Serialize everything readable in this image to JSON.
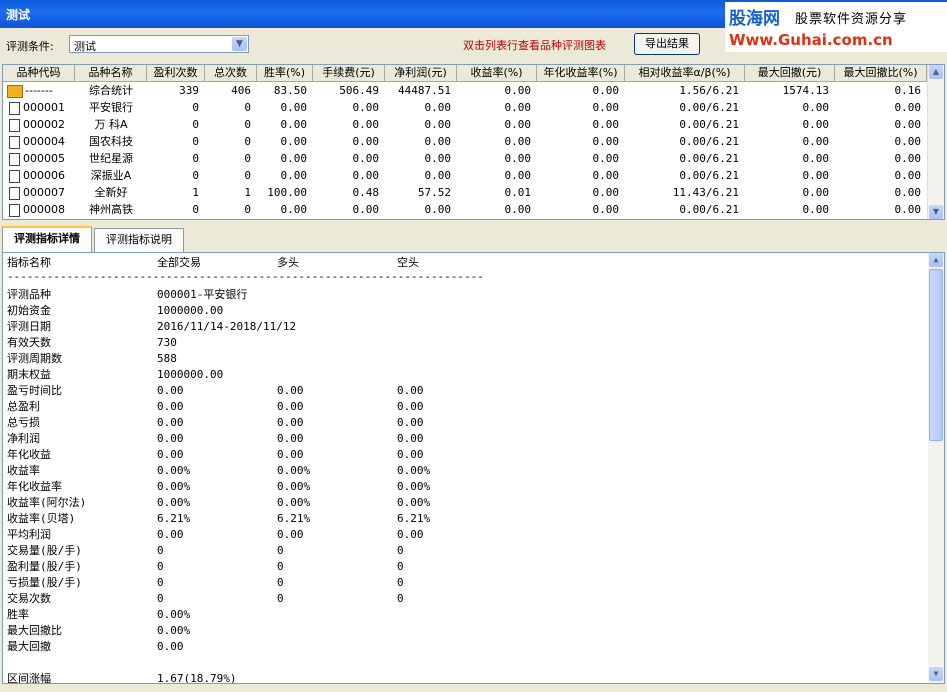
{
  "window": {
    "title": "测试"
  },
  "logo": {
    "line1_a": "股海网",
    "line1_b": "股票软件资源分享",
    "line2": "Www.Guhai.com.cn"
  },
  "condition": {
    "label": "评测条件:",
    "value": "测试",
    "hint": "双击列表行查看品种评测图表",
    "export_label": "导出结果"
  },
  "grid": {
    "headers": [
      "品种代码",
      "品种名称",
      "盈利次数",
      "总次数",
      "胜率(%)",
      "手续费(元)",
      "净利润(元)",
      "收益率(%)",
      "年化收益率(%)",
      "相对收益率α/β(%)",
      "最大回撤(元)",
      "最大回撤比(%)"
    ],
    "rows": [
      {
        "icon": "folder",
        "cells": [
          "-------",
          "综合统计",
          "339",
          "406",
          "83.50",
          "506.49",
          "44487.51",
          "0.00",
          "0.00",
          "1.56/6.21",
          "1574.13",
          "0.16"
        ]
      },
      {
        "icon": "doc",
        "cells": [
          "000001",
          "平安银行",
          "0",
          "0",
          "0.00",
          "0.00",
          "0.00",
          "0.00",
          "0.00",
          "0.00/6.21",
          "0.00",
          "0.00"
        ]
      },
      {
        "icon": "doc",
        "cells": [
          "000002",
          "万 科A",
          "0",
          "0",
          "0.00",
          "0.00",
          "0.00",
          "0.00",
          "0.00",
          "0.00/6.21",
          "0.00",
          "0.00"
        ]
      },
      {
        "icon": "doc",
        "cells": [
          "000004",
          "国农科技",
          "0",
          "0",
          "0.00",
          "0.00",
          "0.00",
          "0.00",
          "0.00",
          "0.00/6.21",
          "0.00",
          "0.00"
        ]
      },
      {
        "icon": "doc",
        "cells": [
          "000005",
          "世纪星源",
          "0",
          "0",
          "0.00",
          "0.00",
          "0.00",
          "0.00",
          "0.00",
          "0.00/6.21",
          "0.00",
          "0.00"
        ]
      },
      {
        "icon": "doc",
        "cells": [
          "000006",
          "深振业A",
          "0",
          "0",
          "0.00",
          "0.00",
          "0.00",
          "0.00",
          "0.00",
          "0.00/6.21",
          "0.00",
          "0.00"
        ]
      },
      {
        "icon": "doc",
        "cells": [
          "000007",
          "全新好",
          "1",
          "1",
          "100.00",
          "0.48",
          "57.52",
          "0.01",
          "0.00",
          "11.43/6.21",
          "0.00",
          "0.00"
        ]
      },
      {
        "icon": "doc",
        "cells": [
          "000008",
          "神州高铁",
          "0",
          "0",
          "0.00",
          "0.00",
          "0.00",
          "0.00",
          "0.00",
          "0.00/6.21",
          "0.00",
          "0.00"
        ]
      }
    ]
  },
  "tabs": [
    "评测指标详情",
    "评测指标说明"
  ],
  "detail": {
    "header": [
      "指标名称",
      "全部交易",
      "多头",
      "空头"
    ],
    "separator": "------------------------------------------------------------------------",
    "rows": [
      [
        "",
        ""
      ],
      [
        "评测品种",
        "000001-平安银行"
      ],
      [
        "初始资金",
        "1000000.00"
      ],
      [
        "评测日期",
        "2016/11/14-2018/11/12"
      ],
      [
        "有效天数",
        "730"
      ],
      [
        "评测周期数",
        "588"
      ],
      [
        "期末权益",
        "1000000.00"
      ],
      [
        "盈亏时间比",
        "0.00",
        "0.00",
        "0.00"
      ],
      [
        "总盈利",
        "0.00",
        "0.00",
        "0.00"
      ],
      [
        "总亏损",
        "0.00",
        "0.00",
        "0.00"
      ],
      [
        "净利润",
        "0.00",
        "0.00",
        "0.00"
      ],
      [
        "年化收益",
        "0.00",
        "0.00",
        "0.00"
      ],
      [
        "收益率",
        "0.00%",
        "0.00%",
        "0.00%"
      ],
      [
        "年化收益率",
        "0.00%",
        "0.00%",
        "0.00%"
      ],
      [
        "收益率(阿尔法)",
        "0.00%",
        "0.00%",
        "0.00%"
      ],
      [
        "收益率(贝塔)",
        "6.21%",
        "6.21%",
        "6.21%"
      ],
      [
        "平均利润",
        "0.00",
        "0.00",
        "0.00"
      ],
      [
        "交易量(股/手)",
        "0",
        "0",
        "0"
      ],
      [
        "盈利量(股/手)",
        "0",
        "0",
        "0"
      ],
      [
        "亏损量(股/手)",
        "0",
        "0",
        "0"
      ],
      [
        "交易次数",
        "0",
        "0",
        "0"
      ],
      [
        "胜率",
        "0.00%"
      ],
      [
        "最大回撤比",
        "0.00%"
      ],
      [
        "最大回撤",
        "0.00"
      ],
      [
        "",
        ""
      ],
      [
        "区间涨幅",
        "1.67(18.79%)"
      ]
    ]
  }
}
